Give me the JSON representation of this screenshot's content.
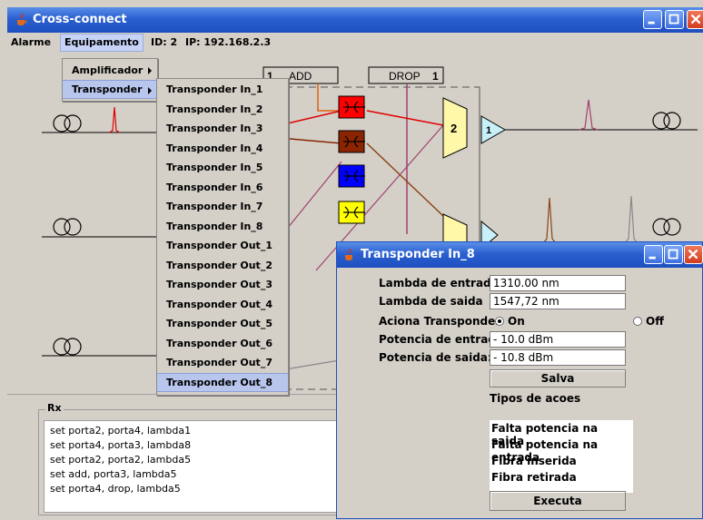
{
  "window": {
    "title": "Cross-connect",
    "accent": "#2a5fd0"
  },
  "menubar": {
    "items": [
      "Alarme",
      "Equipamento"
    ],
    "id_text": "ID: 2",
    "ip_text": "IP: 192.168.2.3"
  },
  "equipamento_menu": {
    "items": [
      "Amplificador",
      "Transponder"
    ]
  },
  "transponder_menu": {
    "items": [
      "Transponder In_1",
      "Transponder In_2",
      "Transponder In_3",
      "Transponder In_4",
      "Transponder In_5",
      "Transponder In_6",
      "Transponder In_7",
      "Transponder In_8",
      "Transponder Out_1",
      "Transponder Out_2",
      "Transponder Out_3",
      "Transponder Out_4",
      "Transponder Out_5",
      "Transponder Out_6",
      "Transponder Out_7",
      "Transponder Out_8"
    ],
    "selected": "Transponder Out_8"
  },
  "diagram": {
    "add_label": "ADD",
    "add_number": "1",
    "drop_label": "DROP",
    "drop_number": "1",
    "mux_labels": [
      "2",
      "1"
    ],
    "switch_colors": [
      "#ff0000",
      "#8b2500",
      "#0000ff",
      "#ffff00"
    ]
  },
  "rx": {
    "legend": "Rx",
    "lines": [
      "set porta2, porta4, lambda1",
      "set porta4, porta3, lambda8",
      "set porta2, porta2, lambda5",
      "set add, porta3, lambda5",
      "set porta4, drop, lambda5"
    ]
  },
  "dialog": {
    "title": "Transponder In_8",
    "lambda_entrada_label": "Lambda de entrada",
    "lambda_entrada_value": "1310.00 nm",
    "lambda_saida_label": "Lambda de saida",
    "lambda_saida_value": "1547,72 nm",
    "aciona_label": "Aciona Transponder",
    "on_label": "On",
    "off_label": "Off",
    "aciona_state": "On",
    "pot_entrada_label": "Potencia de entrada:",
    "pot_entrada_value": "- 10.0 dBm",
    "pot_saida_label": "Potencia de saida:",
    "pot_saida_value": "- 10.8 dBm",
    "salva_label": "Salva",
    "tipos_label": "Tipos de acoes",
    "actions": [
      "Falta potencia na saida",
      "Falta potencia na entrada",
      "Fibra inserida",
      "Fibra retirada"
    ],
    "executa_label": "Executa"
  }
}
